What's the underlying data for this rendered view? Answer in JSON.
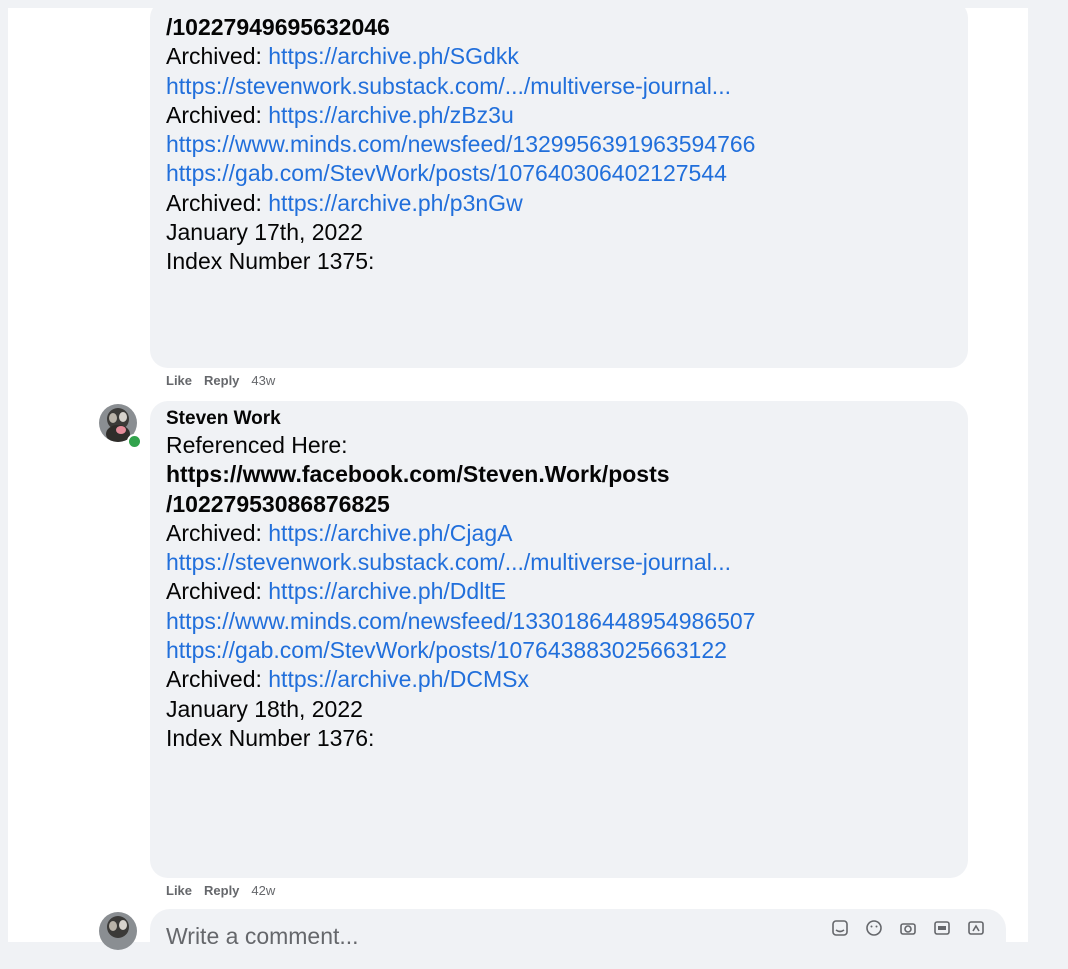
{
  "comment1": {
    "lines": [
      {
        "type": "bold",
        "text": "/10227949695632046"
      },
      {
        "type": "archived",
        "prefix": "Archived: ",
        "link": "https://archive.ph/SGdkk"
      },
      {
        "type": "link",
        "text": "https://stevenwork.substack.com/.../multiverse-journal..."
      },
      {
        "type": "archived",
        "prefix": "Archived: ",
        "link": "https://archive.ph/zBz3u"
      },
      {
        "type": "link",
        "text": "https://www.minds.com/newsfeed/1329956391963594766"
      },
      {
        "type": "link",
        "text": "https://gab.com/StevWork/posts/107640306402127544"
      },
      {
        "type": "archived",
        "prefix": "Archived: ",
        "link": "https://archive.ph/p3nGw"
      },
      {
        "type": "text",
        "text": "January 17th, 2022"
      },
      {
        "type": "text",
        "text": "Index Number 1375:"
      }
    ],
    "actions": {
      "like": "Like",
      "reply": "Reply",
      "time": "43w"
    }
  },
  "comment2": {
    "author": "Steven Work",
    "lines": [
      {
        "type": "text",
        "text": "Referenced Here:"
      },
      {
        "type": "bold",
        "text": "https://www.facebook.com/Steven.Work/posts"
      },
      {
        "type": "bold",
        "text": "/10227953086876825"
      },
      {
        "type": "archived",
        "prefix": "Archived: ",
        "link": "https://archive.ph/CjagA"
      },
      {
        "type": "link",
        "text": "https://stevenwork.substack.com/.../multiverse-journal..."
      },
      {
        "type": "archived",
        "prefix": "Archived: ",
        "link": "https://archive.ph/DdltE"
      },
      {
        "type": "link",
        "text": "https://www.minds.com/newsfeed/1330186448954986507"
      },
      {
        "type": "link",
        "text": "https://gab.com/StevWork/posts/107643883025663122"
      },
      {
        "type": "archived",
        "prefix": "Archived: ",
        "link": "https://archive.ph/DCMSx"
      },
      {
        "type": "text",
        "text": "January 18th, 2022"
      },
      {
        "type": "text",
        "text": "Index Number 1376:"
      }
    ],
    "actions": {
      "like": "Like",
      "reply": "Reply",
      "time": "42w"
    }
  },
  "composer": {
    "placeholder": "Write a comment...",
    "icons": [
      "sticker-icon",
      "emoji-icon",
      "camera-icon",
      "gif-icon",
      "sticker-pack-icon"
    ]
  },
  "colors": {
    "link": "#216fdb",
    "bubble": "#f0f2f5",
    "online": "#31a24c",
    "meta": "#65676b"
  }
}
